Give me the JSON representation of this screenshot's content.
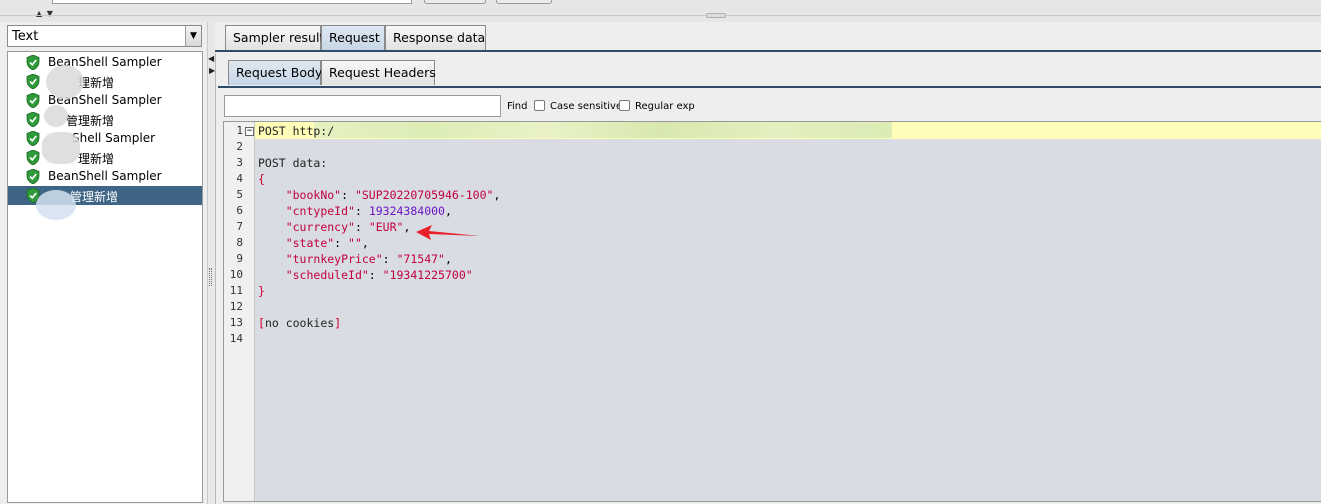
{
  "window": {
    "title_arrows": "▲ ▼"
  },
  "left_panel": {
    "view_select": {
      "value": "Text",
      "arrow": "▼"
    },
    "tree_items": [
      {
        "label": "BeanShell Sampler",
        "status_icon": "green-shield-check"
      },
      {
        "label": "理新增",
        "status_icon": "green-shield-check"
      },
      {
        "label": "BeanShell Sampler",
        "status_icon": "green-shield-check"
      },
      {
        "label": "管理新增",
        "status_icon": "green-shield-check"
      },
      {
        "label": "Shell Sampler",
        "status_icon": "green-shield-check"
      },
      {
        "label": "理新增",
        "status_icon": "green-shield-check"
      },
      {
        "label": "BeanShell Sampler",
        "status_icon": "green-shield-check"
      },
      {
        "label": "管理新增",
        "status_icon": "green-shield-check",
        "selected": true
      }
    ],
    "selected_color": "#3e6585"
  },
  "result_tabs": [
    {
      "label": "Sampler result",
      "active": false
    },
    {
      "label": "Request",
      "active": true
    },
    {
      "label": "Response data",
      "active": false
    }
  ],
  "request_tabs": [
    {
      "label": "Request Body",
      "active": true
    },
    {
      "label": "Request Headers",
      "active": false
    }
  ],
  "find_bar": {
    "search_value": "",
    "find_label": "Find",
    "case_sensitive_label": "Case sensitive",
    "case_sensitive_checked": false,
    "regular_exp_label": "Regular exp",
    "regular_exp_checked": false
  },
  "editor": {
    "line_numbers": [
      "1",
      "2",
      "3",
      "4",
      "5",
      "6",
      "7",
      "8",
      "9",
      "10",
      "11",
      "12",
      "13",
      "14"
    ],
    "fold_marker": "−",
    "lines": {
      "l1": "POST http:/",
      "l3": "POST data:",
      "l4": "{",
      "l5_key": "\"bookNo\"",
      "l5_val": "\"SUP20220705946-100\"",
      "l6_key": "\"cntypeId\"",
      "l6_val": "19324384000",
      "l7_key": "\"currency\"",
      "l7_val": "\"EUR\"",
      "l8_key": "\"state\"",
      "l8_val": "\"\"",
      "l9_key": "\"turnkeyPrice\"",
      "l9_val": "\"71547\"",
      "l10_key": "\"scheduleId\"",
      "l10_val": "\"19341225700\"",
      "l11": "}",
      "l13_open": "[",
      "l13_text": "no cookies",
      "l13_close": "]"
    },
    "colors": {
      "highlight_line": "#fffdb8",
      "string": "#c2003a",
      "number": "#6b14c4",
      "annotation_arrow": "#e8202a"
    }
  }
}
